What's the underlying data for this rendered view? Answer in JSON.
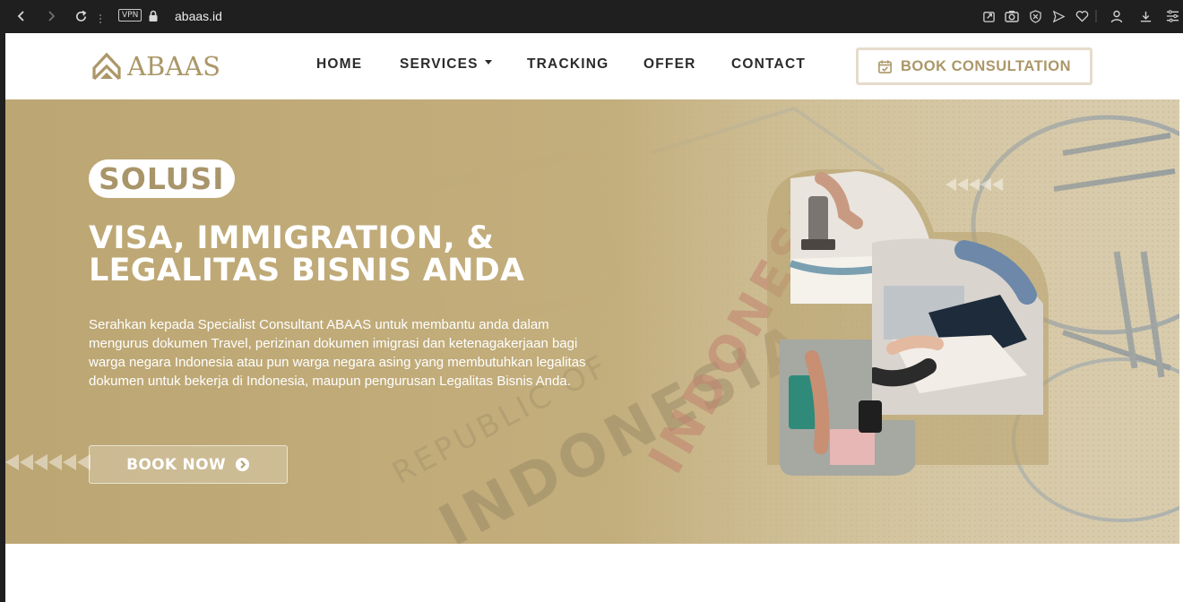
{
  "browser": {
    "url": "abaas.id",
    "vpn_label": "VPN"
  },
  "header": {
    "logo_text": "ABAAS",
    "nav": [
      {
        "label": "HOME"
      },
      {
        "label": "SERVICES"
      },
      {
        "label": "TRACKING"
      },
      {
        "label": "OFFER"
      },
      {
        "label": "CONTACT"
      }
    ],
    "cta_label": "BOOK CONSULTATION"
  },
  "hero": {
    "badge": "SOLUSI",
    "title_line1": "VISA, IMMIGRATION, &",
    "title_line2": "LEGALITAS BISNIS ANDA",
    "description": "Serahkan kepada Specialist Consultant ABAAS untuk membantu anda dalam mengurus dokumen Travel, perizinan dokumen imigrasi dan ketenagakerjaan bagi warga negara Indonesia atau pun warga negara asing yang membutuhkan legalitas dokumen untuk bekerja di Indonesia, maupun pengurusan Legalitas Bisnis Anda.",
    "button_label": "BOOK NOW",
    "background_text_1": "REPUBLIC OF",
    "background_text_2": "INDONESIA"
  },
  "colors": {
    "gold": "#ab9768",
    "hero_overlay": "#c3ad78",
    "browser_bar": "#1f1f1f"
  }
}
